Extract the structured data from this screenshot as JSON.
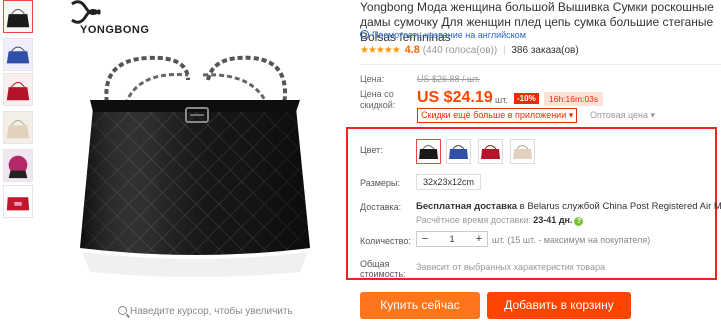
{
  "brand": {
    "logo_text": "YONGBONG"
  },
  "gallery": {
    "zoom_hint": "Наведите курсор, чтобы увеличить",
    "thumb_count": 6
  },
  "product": {
    "title": "Yongbong Мода женщина большой Вышивка Сумки роскошные дамы сумочку Для женщин плед цепь сумка большие стеганые Bolsas femininas",
    "translate_link": "Посмотреть название на английском",
    "stars": "★★★★★",
    "rating": "4.8",
    "votes": "(440 голоса(ов))",
    "orders": "386 заказа(ов)"
  },
  "pricing": {
    "price_label": "Цена:",
    "old_price": "US $26.88 / шт.",
    "discount_label": "Цена со скидкой:",
    "price": "US $24.19",
    "per_unit": "/ шт.",
    "discount": "-10%",
    "timer": "16h:16m:03s",
    "app_discount": "Скидки ещё больше в приложении ▾",
    "wholesale": "Оптовая цена ▾"
  },
  "sku": {
    "color_label": "Цвет:",
    "size_label": "Размеры:",
    "size_value": "32x23x12cm",
    "shipping_label": "Доставка:",
    "shipping_prefix": "Бесплатная доставка",
    "shipping_rest": " в Belarus службой China Post Registered Air Mail",
    "delivery_label": "Расчётное время доставки: ",
    "delivery_days": "23-41 дн.",
    "qty_label": "Количество:",
    "qty_minus": "−",
    "qty_value": "1",
    "qty_plus": "+",
    "qty_info": "шт. (15 шт. - максимум на покупателя)",
    "total_label": "Общая стоимость:",
    "total_info": "Зависит от выбранных характеристик товара"
  },
  "actions": {
    "buy_now": "Купить сейчас",
    "add_to_cart": "Добавить в корзину"
  },
  "colors": {
    "accent": "#ff4400",
    "buy": "#ff7519",
    "price": "#ff4400",
    "highlight_box": "#ee2222"
  }
}
